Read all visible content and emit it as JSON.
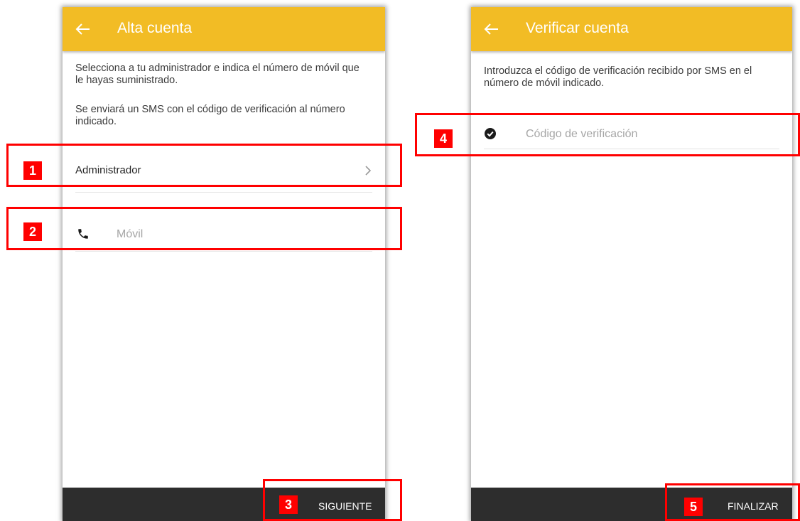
{
  "left_screen": {
    "title": "Alta cuenta",
    "description_1": "Selecciona a tu administrador e indica el número de móvil que le hayas suministrado.",
    "description_2": "Se enviará un SMS con el código de verificación al número indicado.",
    "admin_row_label": "Administrador",
    "mobile_placeholder": "Móvil",
    "next_button": "SIGUIENTE"
  },
  "right_screen": {
    "title": "Verificar cuenta",
    "description": "Introduzca el código de verificación recibido por SMS en el número de móvil indicado.",
    "code_placeholder": "Código de verificación",
    "finish_button": "FINALIZAR"
  },
  "annotations": [
    "1",
    "2",
    "3",
    "4",
    "5"
  ],
  "icons": {
    "back": "arrow-left-icon",
    "chevron": "chevron-right-icon",
    "phone": "phone-icon",
    "check": "check-circle-icon"
  },
  "colors": {
    "appbar": "#f2bc25",
    "bottombar": "#2d2d2d",
    "annotation": "#ff0000"
  }
}
